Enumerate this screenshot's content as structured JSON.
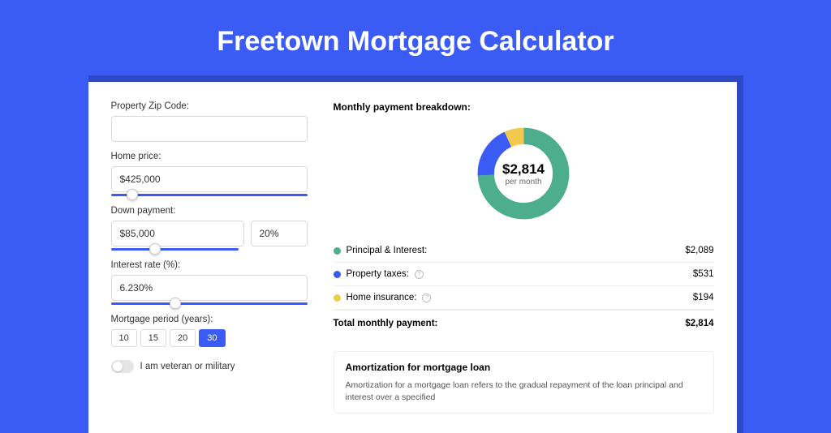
{
  "title": "Freetown Mortgage Calculator",
  "form": {
    "zip": {
      "label": "Property Zip Code:",
      "value": ""
    },
    "price": {
      "label": "Home price:",
      "value": "$425,000",
      "slider_pct": 8
    },
    "down": {
      "label": "Down payment:",
      "amount": "$85,000",
      "pct": "20%",
      "slider_pct": 20
    },
    "rate": {
      "label": "Interest rate (%):",
      "value": "6.230%",
      "slider_pct": 30
    },
    "period": {
      "label": "Mortgage period (years):",
      "options": [
        "10",
        "15",
        "20",
        "30"
      ],
      "selected": "30"
    },
    "veteran": {
      "label": "I am veteran or military",
      "on": false
    }
  },
  "breakdown": {
    "title": "Monthly payment breakdown:",
    "center_amount": "$2,814",
    "center_sub": "per month",
    "items": [
      {
        "label": "Principal & Interest:",
        "value": "$2,089",
        "color": "#4cae8d",
        "info": false
      },
      {
        "label": "Property taxes:",
        "value": "$531",
        "color": "#3a5cf5",
        "info": true
      },
      {
        "label": "Home insurance:",
        "value": "$194",
        "color": "#f2c94c",
        "info": true
      }
    ],
    "total_label": "Total monthly payment:",
    "total_value": "$2,814"
  },
  "amort": {
    "title": "Amortization for mortgage loan",
    "text": "Amortization for a mortgage loan refers to the gradual repayment of the loan principal and interest over a specified"
  },
  "chart_data": {
    "type": "pie",
    "title": "Monthly payment breakdown",
    "series": [
      {
        "name": "Principal & Interest",
        "value": 2089,
        "color": "#4cae8d"
      },
      {
        "name": "Property taxes",
        "value": 531,
        "color": "#3a5cf5"
      },
      {
        "name": "Home insurance",
        "value": 194,
        "color": "#f2c94c"
      }
    ],
    "total": 2814
  }
}
